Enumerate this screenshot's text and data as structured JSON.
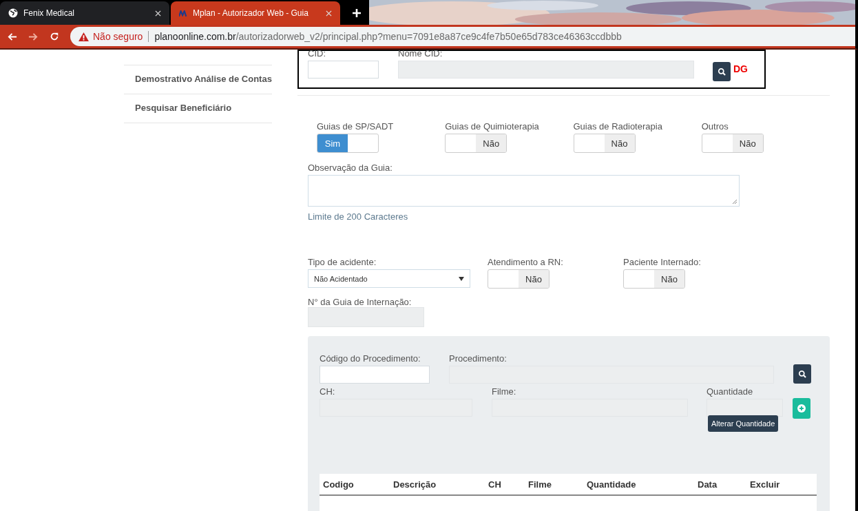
{
  "browser": {
    "tabs": [
      {
        "title": "Fenix Medical",
        "selected": false
      },
      {
        "title": "Mplan - Autorizador Web - Guia",
        "selected": true
      }
    ],
    "security": "Não seguro",
    "url_host": "planoonline.com.br",
    "url_path": "/autorizadorweb_v2/principal.php?menu=7091e8a87ce9c4fe7b50e65d783ce46363ccdbbb"
  },
  "sidebar": {
    "items": [
      {
        "label": "Demostrativo Análise de Contas"
      },
      {
        "label": "Pesquisar Beneficiário"
      }
    ]
  },
  "cid": {
    "cid_label": "CID:",
    "name_label": "Nome CID:",
    "note": "DG"
  },
  "guide_types": [
    {
      "label": "Guias de SP/SADT",
      "on": true,
      "text": "Sim"
    },
    {
      "label": "Guias de Quimioterapia",
      "on": false,
      "text": "Não"
    },
    {
      "label": "Guias de Radioterapia",
      "on": false,
      "text": "Não"
    },
    {
      "label": "Outros",
      "on": false,
      "text": "Não"
    }
  ],
  "observation": {
    "label": "Observação da Guia:",
    "hint": "Limite de 200 Caracteres"
  },
  "accident": {
    "label": "Tipo de acidente:",
    "value": "Não Acidentado"
  },
  "flags": [
    {
      "label": "Atendimento a RN:",
      "on": false,
      "text": "Não"
    },
    {
      "label": "Paciente Internado:",
      "on": false,
      "text": "Não"
    }
  ],
  "internment": {
    "label": "N° da Guia de Internação:"
  },
  "procedure": {
    "code_label": "Código do Procedimento:",
    "name_label": "Procedimento:",
    "ch_label": "CH:",
    "film_label": "Filme:",
    "qty_label": "Quantidade",
    "tooltip": "Alterar Quantidade"
  },
  "table": {
    "columns": [
      "Codigo",
      "Descrição",
      "CH",
      "Filme",
      "Quantidade",
      "Data",
      "Excluir"
    ]
  }
}
